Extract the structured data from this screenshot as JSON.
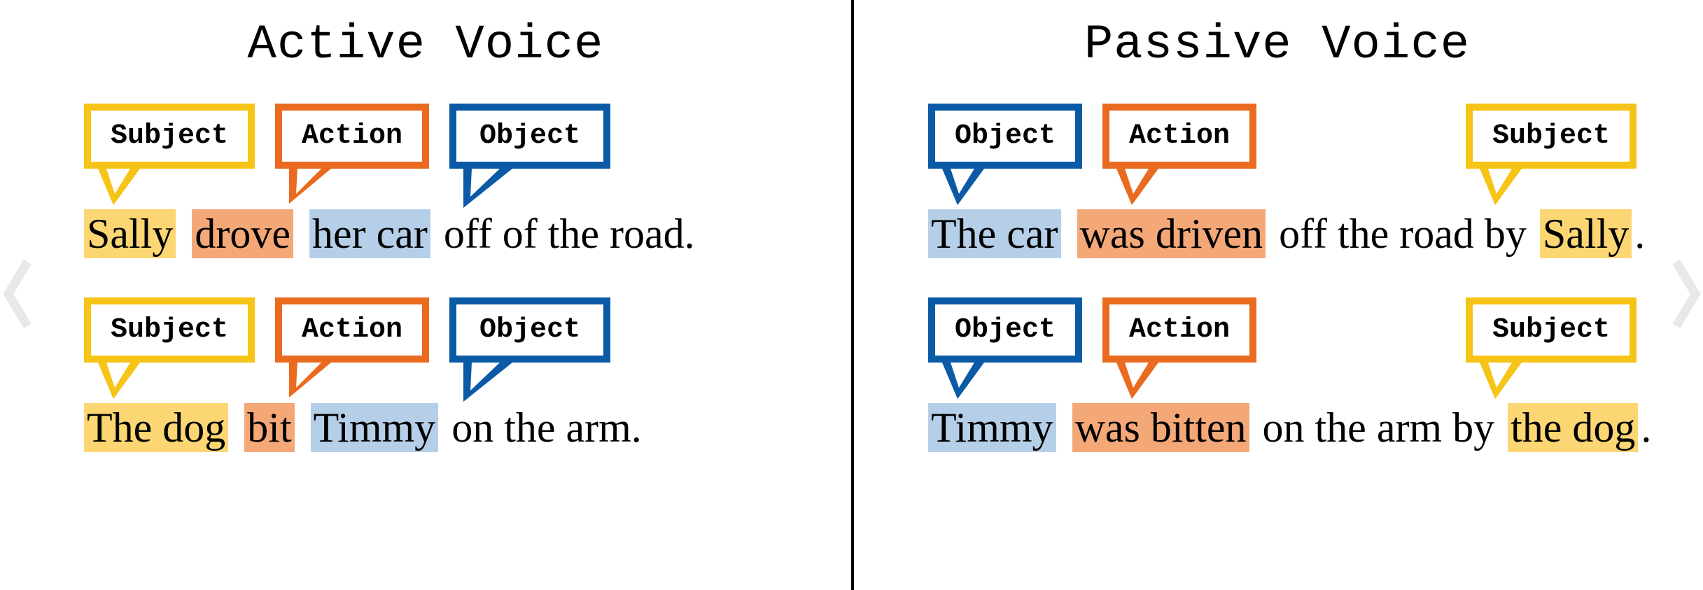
{
  "colors": {
    "border_yellow": "#f6c317",
    "border_orange": "#ea6b1f",
    "border_blue": "#0b5aa6",
    "hl_yellow": "#fbd673",
    "hl_orange": "#f4a878",
    "hl_blue": "#b6cfe8"
  },
  "labels": {
    "subject": "Subject",
    "action": "Action",
    "object": "Object"
  },
  "left": {
    "title": "Active Voice",
    "examples": [
      {
        "bubbles": [
          "subject",
          "action",
          "object"
        ],
        "fragments": [
          {
            "text": "Sally",
            "hl": "yellow"
          },
          {
            "text": " ",
            "hl": "none"
          },
          {
            "text": "drove",
            "hl": "orange"
          },
          {
            "text": " ",
            "hl": "none"
          },
          {
            "text": "her car",
            "hl": "blue"
          },
          {
            "text": " off of the road.",
            "hl": "none"
          }
        ]
      },
      {
        "bubbles": [
          "subject",
          "action",
          "object"
        ],
        "fragments": [
          {
            "text": "The dog",
            "hl": "yellow"
          },
          {
            "text": " ",
            "hl": "none"
          },
          {
            "text": "bit",
            "hl": "orange"
          },
          {
            "text": " ",
            "hl": "none"
          },
          {
            "text": "Timmy",
            "hl": "blue"
          },
          {
            "text": " on the arm.",
            "hl": "none"
          }
        ]
      }
    ]
  },
  "right": {
    "title": "Passive Voice",
    "examples": [
      {
        "bubbles": [
          "object",
          "action",
          "subject"
        ],
        "fragments": [
          {
            "text": "The car",
            "hl": "blue"
          },
          {
            "text": " ",
            "hl": "none"
          },
          {
            "text": "was driven",
            "hl": "orange"
          },
          {
            "text": " off the road by ",
            "hl": "none"
          },
          {
            "text": "Sally",
            "hl": "yellow"
          },
          {
            "text": ".",
            "hl": "none"
          }
        ]
      },
      {
        "bubbles": [
          "object",
          "action",
          "subject"
        ],
        "fragments": [
          {
            "text": "Timmy",
            "hl": "blue"
          },
          {
            "text": " ",
            "hl": "none"
          },
          {
            "text": "was bitten",
            "hl": "orange"
          },
          {
            "text": " on the arm by ",
            "hl": "none"
          },
          {
            "text": "the dog",
            "hl": "yellow"
          },
          {
            "text": ".",
            "hl": "none"
          }
        ]
      }
    ]
  }
}
